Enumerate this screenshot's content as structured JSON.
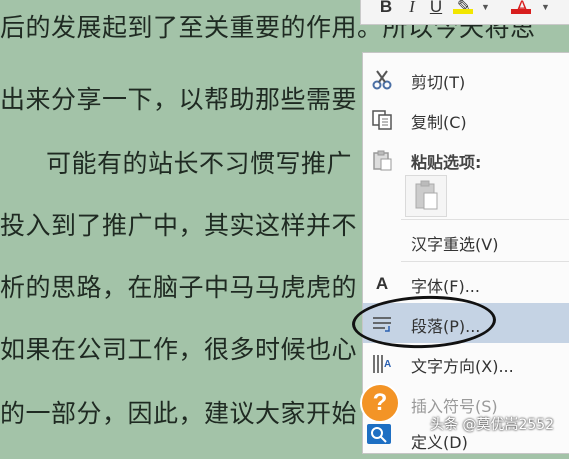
{
  "document": {
    "lines": [
      "后的发展起到了至关重要的作用。所以今天将思",
      "出来分享一下，以帮助那些需要",
      "可能有的站长不习惯写推广",
      "投入到了推广中，其实这样并不",
      "析的思路，在脑子中马马虎虎的",
      "如果在公司工作，很多时候也心",
      "的一部分，因此，建议大家开始"
    ]
  },
  "mini_toolbar": {
    "bold": "B",
    "italic": "I",
    "underline": "U",
    "highlight": "✎",
    "font_color": "A",
    "highlight_color": "#f2e600",
    "font_color_bar": "#d81e1e"
  },
  "context_menu": {
    "items": [
      {
        "label": "剪切(T)",
        "icon": "scissors-icon"
      },
      {
        "label": "复制(C)",
        "icon": "copy-icon"
      },
      {
        "label": "粘贴选项:",
        "icon": "paste-icon"
      },
      {
        "label": "汉字重选(V)",
        "icon": ""
      },
      {
        "label": "字体(F)...",
        "icon": "font-icon"
      },
      {
        "label": "段落(P)...",
        "icon": "paragraph-icon"
      },
      {
        "label": "文字方向(X)...",
        "icon": "text-direction-icon"
      },
      {
        "label": "插入符号(S)",
        "icon": ""
      },
      {
        "label": "定义(D)",
        "icon": "search-icon"
      }
    ],
    "highlight_color": "#c5d3e4"
  },
  "watermark": {
    "text": "头条 @莫优嵩2552"
  },
  "help_icon": {
    "glyph": "?",
    "color": "#f39426"
  }
}
